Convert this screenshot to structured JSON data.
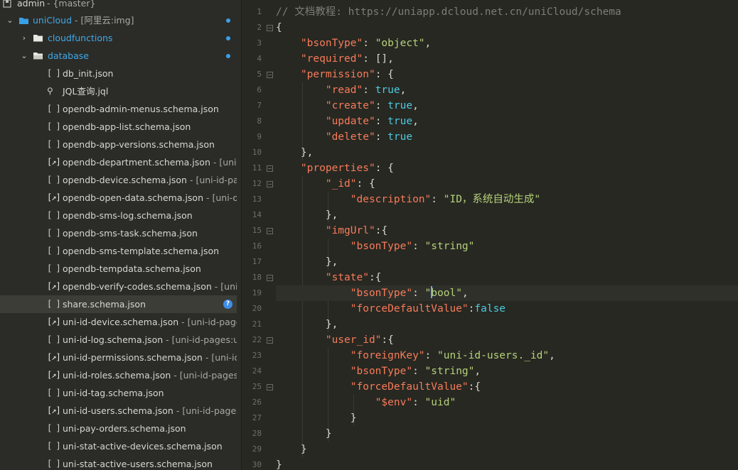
{
  "sidebar": {
    "header": {
      "name": "admin",
      "branch": "{master}"
    },
    "root": {
      "name": "uniCloud",
      "suffix": " - [阿里云:img]"
    },
    "cloudfunctions": {
      "name": "cloudfunctions"
    },
    "database": {
      "name": "database"
    },
    "files": [
      {
        "name": "db_init.json",
        "suffix": "",
        "icon": "[ ]",
        "linked": false
      },
      {
        "name": "JQL查询.jql",
        "suffix": "",
        "icon": "⚲",
        "linked": false
      },
      {
        "name": "opendb-admin-menus.schema.json",
        "suffix": "",
        "icon": "[ ]",
        "linked": false
      },
      {
        "name": "opendb-app-list.schema.json",
        "suffix": "",
        "icon": "[ ]",
        "linked": false
      },
      {
        "name": "opendb-app-versions.schema.json",
        "suffix": "",
        "icon": "[ ]",
        "linked": false
      },
      {
        "name": "opendb-department.schema.json",
        "suffix": " - [uni-id",
        "icon": "[↗]",
        "linked": true
      },
      {
        "name": "opendb-device.schema.json",
        "suffix": " - [uni-id-page",
        "icon": "[ ]",
        "linked": false
      },
      {
        "name": "opendb-open-data.schema.json",
        "suffix": " - [uni-ope",
        "icon": "[↗]",
        "linked": true
      },
      {
        "name": "opendb-sms-log.schema.json",
        "suffix": "",
        "icon": "[ ]",
        "linked": false
      },
      {
        "name": "opendb-sms-task.schema.json",
        "suffix": "",
        "icon": "[ ]",
        "linked": false
      },
      {
        "name": "opendb-sms-template.schema.json",
        "suffix": "",
        "icon": "[ ]",
        "linked": false
      },
      {
        "name": "opendb-tempdata.schema.json",
        "suffix": "",
        "icon": "[ ]",
        "linked": false
      },
      {
        "name": "opendb-verify-codes.schema.json",
        "suffix": " - [uni-ca",
        "icon": "[↗]",
        "linked": true
      },
      {
        "name": "share.schema.json",
        "suffix": "",
        "icon": "[ ]",
        "linked": false,
        "selected": true,
        "badge": "?"
      },
      {
        "name": "uni-id-device.schema.json",
        "suffix": " - [uni-id-pages:",
        "icon": "[↗]",
        "linked": true
      },
      {
        "name": "uni-id-log.schema.json",
        "suffix": " - [uni-id-pages:uni",
        "icon": "[ ]",
        "linked": false
      },
      {
        "name": "uni-id-permissions.schema.json",
        "suffix": " - [uni-id-p",
        "icon": "[↗]",
        "linked": true
      },
      {
        "name": "uni-id-roles.schema.json",
        "suffix": " - [uni-id-pages:u",
        "icon": "[↗]",
        "linked": true
      },
      {
        "name": "uni-id-tag.schema.json",
        "suffix": "",
        "icon": "[ ]",
        "linked": false
      },
      {
        "name": "uni-id-users.schema.json",
        "suffix": " - [uni-id-pages:u",
        "icon": "[↗]",
        "linked": true
      },
      {
        "name": "uni-pay-orders.schema.json",
        "suffix": "",
        "icon": "[ ]",
        "linked": false
      },
      {
        "name": "uni-stat-active-devices.schema.json",
        "suffix": "",
        "icon": "[ ]",
        "linked": false
      },
      {
        "name": "uni-stat-active-users.schema.json",
        "suffix": "",
        "icon": "[ ]",
        "linked": false
      }
    ]
  },
  "editor": {
    "current_line": 19,
    "lines": [
      {
        "n": "1",
        "fold": false,
        "tokens": [
          [
            "c",
            "// 文档教程: https://uniapp.dcloud.net.cn/uniCloud/schema"
          ]
        ]
      },
      {
        "n": "2",
        "fold": true,
        "tokens": [
          [
            "p",
            "{"
          ]
        ]
      },
      {
        "n": "3",
        "fold": false,
        "tokens": [
          [
            "p",
            "    "
          ],
          [
            "k",
            "\"bsonType\""
          ],
          [
            "p",
            ": "
          ],
          [
            "s",
            "\"object\""
          ],
          [
            "p",
            ","
          ]
        ]
      },
      {
        "n": "4",
        "fold": false,
        "tokens": [
          [
            "p",
            "    "
          ],
          [
            "k",
            "\"required\""
          ],
          [
            "p",
            ": [],"
          ]
        ]
      },
      {
        "n": "5",
        "fold": true,
        "tokens": [
          [
            "p",
            "    "
          ],
          [
            "k",
            "\"permission\""
          ],
          [
            "p",
            ": {"
          ]
        ]
      },
      {
        "n": "6",
        "fold": false,
        "tokens": [
          [
            "p",
            "        "
          ],
          [
            "k",
            "\"read\""
          ],
          [
            "p",
            ": "
          ],
          [
            "b",
            "true"
          ],
          [
            "p",
            ","
          ]
        ]
      },
      {
        "n": "7",
        "fold": false,
        "tokens": [
          [
            "p",
            "        "
          ],
          [
            "k",
            "\"create\""
          ],
          [
            "p",
            ": "
          ],
          [
            "b",
            "true"
          ],
          [
            "p",
            ","
          ]
        ]
      },
      {
        "n": "8",
        "fold": false,
        "tokens": [
          [
            "p",
            "        "
          ],
          [
            "k",
            "\"update\""
          ],
          [
            "p",
            ": "
          ],
          [
            "b",
            "true"
          ],
          [
            "p",
            ","
          ]
        ]
      },
      {
        "n": "9",
        "fold": false,
        "tokens": [
          [
            "p",
            "        "
          ],
          [
            "k",
            "\"delete\""
          ],
          [
            "p",
            ": "
          ],
          [
            "b",
            "true"
          ]
        ]
      },
      {
        "n": "10",
        "fold": false,
        "tokens": [
          [
            "p",
            "    },"
          ]
        ]
      },
      {
        "n": "11",
        "fold": true,
        "tokens": [
          [
            "p",
            "    "
          ],
          [
            "k",
            "\"properties\""
          ],
          [
            "p",
            ": {"
          ]
        ]
      },
      {
        "n": "12",
        "fold": true,
        "tokens": [
          [
            "p",
            "        "
          ],
          [
            "k",
            "\"_id\""
          ],
          [
            "p",
            ": {"
          ]
        ]
      },
      {
        "n": "13",
        "fold": false,
        "tokens": [
          [
            "p",
            "            "
          ],
          [
            "k",
            "\"description\""
          ],
          [
            "p",
            ": "
          ],
          [
            "s",
            "\"ID，系统自动生成\""
          ]
        ]
      },
      {
        "n": "14",
        "fold": false,
        "tokens": [
          [
            "p",
            "        },"
          ]
        ]
      },
      {
        "n": "15",
        "fold": true,
        "tokens": [
          [
            "p",
            "        "
          ],
          [
            "k",
            "\"imgUrl\""
          ],
          [
            "p",
            ":{"
          ]
        ]
      },
      {
        "n": "16",
        "fold": false,
        "tokens": [
          [
            "p",
            "            "
          ],
          [
            "k",
            "\"bsonType\""
          ],
          [
            "p",
            ": "
          ],
          [
            "s",
            "\"string\""
          ]
        ]
      },
      {
        "n": "17",
        "fold": false,
        "tokens": [
          [
            "p",
            "        },"
          ]
        ]
      },
      {
        "n": "18",
        "fold": true,
        "tokens": [
          [
            "p",
            "        "
          ],
          [
            "k",
            "\"state\""
          ],
          [
            "p",
            ":{"
          ]
        ]
      },
      {
        "n": "19",
        "fold": false,
        "tokens": [
          [
            "p",
            "            "
          ],
          [
            "k",
            "\"bsonType\""
          ],
          [
            "p",
            ": "
          ],
          [
            "s",
            "\""
          ],
          [
            "cursor",
            ""
          ],
          [
            "s",
            "bool\""
          ],
          [
            "p",
            ","
          ]
        ]
      },
      {
        "n": "20",
        "fold": false,
        "tokens": [
          [
            "p",
            "            "
          ],
          [
            "k",
            "\"forceDefaultValue\""
          ],
          [
            "p",
            ":"
          ],
          [
            "b",
            "false"
          ]
        ]
      },
      {
        "n": "21",
        "fold": false,
        "tokens": [
          [
            "p",
            "        },"
          ]
        ]
      },
      {
        "n": "22",
        "fold": true,
        "tokens": [
          [
            "p",
            "        "
          ],
          [
            "k",
            "\"user_id\""
          ],
          [
            "p",
            ":{"
          ]
        ]
      },
      {
        "n": "23",
        "fold": false,
        "tokens": [
          [
            "p",
            "            "
          ],
          [
            "k",
            "\"foreignKey\""
          ],
          [
            "p",
            ": "
          ],
          [
            "s",
            "\"uni-id-users._id\""
          ],
          [
            "p",
            ","
          ]
        ]
      },
      {
        "n": "24",
        "fold": false,
        "tokens": [
          [
            "p",
            "            "
          ],
          [
            "k",
            "\"bsonType\""
          ],
          [
            "p",
            ": "
          ],
          [
            "s",
            "\"string\""
          ],
          [
            "p",
            ","
          ]
        ]
      },
      {
        "n": "25",
        "fold": true,
        "tokens": [
          [
            "p",
            "            "
          ],
          [
            "k",
            "\"forceDefaultValue\""
          ],
          [
            "p",
            ":{"
          ]
        ]
      },
      {
        "n": "26",
        "fold": false,
        "tokens": [
          [
            "p",
            "                "
          ],
          [
            "k",
            "\"$env\""
          ],
          [
            "p",
            ": "
          ],
          [
            "s",
            "\"uid\""
          ]
        ]
      },
      {
        "n": "27",
        "fold": false,
        "tokens": [
          [
            "p",
            "            }"
          ]
        ]
      },
      {
        "n": "28",
        "fold": false,
        "tokens": [
          [
            "p",
            "        }"
          ]
        ]
      },
      {
        "n": "29",
        "fold": false,
        "tokens": [
          [
            "p",
            "    }"
          ]
        ]
      },
      {
        "n": "30",
        "fold": false,
        "tokens": [
          [
            "p",
            "}"
          ]
        ]
      }
    ]
  }
}
